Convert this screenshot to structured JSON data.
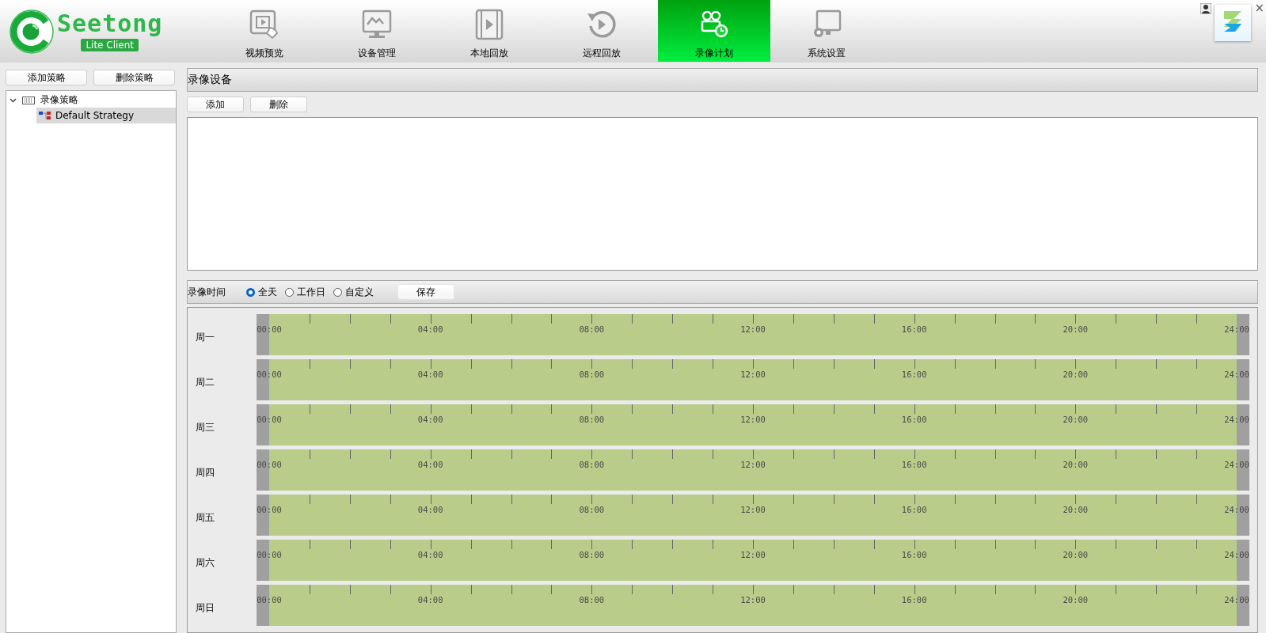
{
  "logo": {
    "name": "Seetong",
    "badge": "Lite Client"
  },
  "tabs": [
    {
      "label": "视频预览",
      "kind": "preview",
      "selected": false
    },
    {
      "label": "设备管理",
      "kind": "device",
      "selected": false
    },
    {
      "label": "本地回放",
      "kind": "film",
      "selected": false
    },
    {
      "label": "远程回放",
      "kind": "replay",
      "selected": false
    },
    {
      "label": "录像计划",
      "kind": "schedule",
      "selected": true
    },
    {
      "label": "系统设置",
      "kind": "settings",
      "selected": false
    }
  ],
  "close": "×",
  "strategy_buttons": [
    "添加策略",
    "删除策略"
  ],
  "tree": [
    {
      "label": "录像策略",
      "expanded": true,
      "children": [
        {
          "label": "Default Strategy",
          "selected": true
        }
      ]
    }
  ],
  "device_section": {
    "title": "录像设备",
    "buttons": [
      "添加",
      "删除"
    ]
  },
  "record_time": {
    "label": "录像时间",
    "options": [
      {
        "label": "全天",
        "selected": true
      },
      {
        "label": "工作日",
        "selected": false
      },
      {
        "label": "自定义",
        "selected": false
      }
    ],
    "save": "保存"
  },
  "schedule": [
    {
      "day": "周一",
      "recording": true,
      "labels": [
        "00:00",
        "04:00",
        "08:00",
        "12:00",
        "16:00",
        "20:00",
        "24:00"
      ]
    },
    {
      "day": "周二",
      "recording": true,
      "labels": [
        "00:00",
        "04:00",
        "08:00",
        "12:00",
        "16:00",
        "20:00",
        "24:00"
      ]
    },
    {
      "day": "周三",
      "recording": true,
      "labels": [
        "00:00",
        "04:00",
        "08:00",
        "12:00",
        "16:00",
        "20:00",
        "24:00"
      ]
    },
    {
      "day": "周四",
      "recording": true,
      "labels": [
        "00:00",
        "04:00",
        "08:00",
        "12:00",
        "16:00",
        "20:00",
        "24:00"
      ]
    },
    {
      "day": "周五",
      "recording": true,
      "labels": [
        "00:00",
        "04:00",
        "08:00",
        "12:00",
        "16:00",
        "20:00",
        "24:00"
      ]
    },
    {
      "day": "周六",
      "recording": true,
      "labels": [
        "00:00",
        "04:00",
        "08:00",
        "12:00",
        "16:00",
        "20:00",
        "24:00"
      ]
    },
    {
      "day": "周日",
      "recording": true,
      "labels": [
        "00:00",
        "04:00",
        "08:00",
        "12:00",
        "16:00",
        "20:00",
        "24:00"
      ]
    }
  ]
}
